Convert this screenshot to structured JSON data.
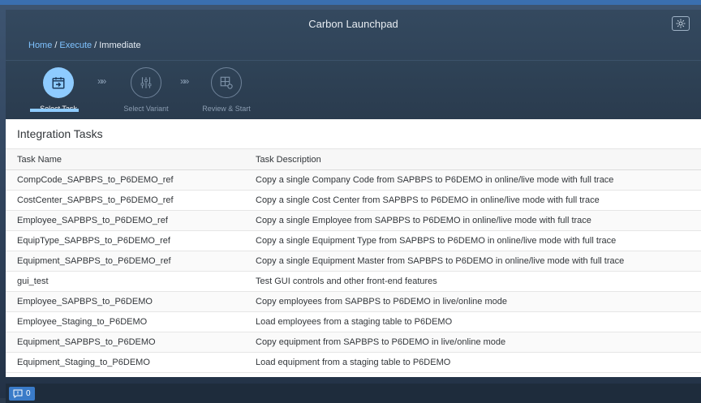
{
  "shell": {
    "title": "Carbon Launchpad",
    "settings_icon": "gear-icon"
  },
  "breadcrumb": {
    "items": [
      "Home",
      "Execute",
      "Immediate"
    ]
  },
  "wizard": {
    "steps": [
      {
        "label": "Select Task",
        "icon": "calendar-arrow-icon",
        "state": "active"
      },
      {
        "label": "Select Variant",
        "icon": "sliders-icon",
        "state": "inactive"
      },
      {
        "label": "Review & Start",
        "icon": "grid-gear-icon",
        "state": "inactive"
      }
    ]
  },
  "panel": {
    "title": "Integration Tasks",
    "columns": [
      "Task Name",
      "Task Description"
    ],
    "rows": [
      [
        "CompCode_SAPBPS_to_P6DEMO_ref",
        "Copy a single Company Code from SAPBPS to P6DEMO in online/live mode with full trace"
      ],
      [
        "CostCenter_SAPBPS_to_P6DEMO_ref",
        "Copy a single Cost Center from SAPBPS to P6DEMO in online/live mode with full trace"
      ],
      [
        "Employee_SAPBPS_to_P6DEMO_ref",
        "Copy a single Employee from SAPBPS to P6DEMO in online/live mode with full trace"
      ],
      [
        "EquipType_SAPBPS_to_P6DEMO_ref",
        "Copy a single Equipment Type from SAPBPS to P6DEMO in online/live mode with full trace"
      ],
      [
        "Equipment_SAPBPS_to_P6DEMO_ref",
        "Copy a single Equipment Master from SAPBPS to P6DEMO in online/live mode with full trace"
      ],
      [
        "gui_test",
        "Test GUI controls and other front-end features"
      ],
      [
        "Employee_SAPBPS_to_P6DEMO",
        "Copy employees from SAPBPS to P6DEMO in live/online mode"
      ],
      [
        "Employee_Staging_to_P6DEMO",
        "Load employees from a staging table to P6DEMO"
      ],
      [
        "Equipment_SAPBPS_to_P6DEMO",
        "Copy equipment from SAPBPS to P6DEMO in live/online mode"
      ],
      [
        "Equipment_Staging_to_P6DEMO",
        "Load equipment from a staging table to P6DEMO"
      ]
    ]
  },
  "footer": {
    "message_count": "0",
    "message_icon": "message-icon"
  },
  "colors": {
    "accent": "#8ecbff",
    "link": "#7fc3ff",
    "footer_button": "#3a7bc8"
  }
}
